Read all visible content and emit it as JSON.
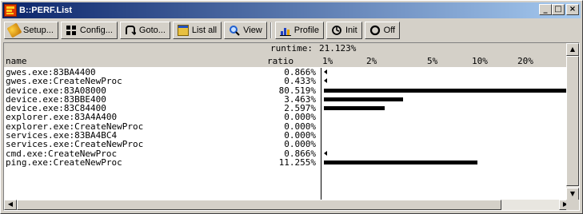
{
  "window": {
    "title": "B::PERF.List"
  },
  "toolbar": {
    "setup": "Setup...",
    "config": "Config...",
    "goto": "Goto...",
    "list_all": "List all",
    "view": "View",
    "profile": "Profile",
    "init": "Init",
    "off": "Off"
  },
  "header": {
    "runtime_label": "runtime:",
    "runtime_value": "21.123%",
    "name": "name",
    "ratio": "ratio",
    "ticks": [
      "1%",
      "2%",
      "5%",
      "10%",
      "20%"
    ]
  },
  "rows": [
    {
      "name": "gwes.exe:83BA4400",
      "ratio": "0.866%",
      "ratio_value": 0.866,
      "bar": "arrow"
    },
    {
      "name": "gwes.exe:CreateNewProc",
      "ratio": "0.433%",
      "ratio_value": 0.433,
      "bar": "arrow"
    },
    {
      "name": "device.exe:83A08000",
      "ratio": "80.519%",
      "ratio_value": 80.519,
      "bar": "bar"
    },
    {
      "name": "device.exe:83BBE400",
      "ratio": "3.463%",
      "ratio_value": 3.463,
      "bar": "bar"
    },
    {
      "name": "device.exe:83C84400",
      "ratio": "2.597%",
      "ratio_value": 2.597,
      "bar": "bar"
    },
    {
      "name": "explorer.exe:83A4A400",
      "ratio": "0.000%",
      "ratio_value": 0.0,
      "bar": "none"
    },
    {
      "name": "explorer.exe:CreateNewProc",
      "ratio": "0.000%",
      "ratio_value": 0.0,
      "bar": "none"
    },
    {
      "name": "services.exe:83BA4BC4",
      "ratio": "0.000%",
      "ratio_value": 0.0,
      "bar": "none"
    },
    {
      "name": "services.exe:CreateNewProc",
      "ratio": "0.000%",
      "ratio_value": 0.0,
      "bar": "none"
    },
    {
      "name": "cmd.exe:CreateNewProc",
      "ratio": "0.866%",
      "ratio_value": 0.866,
      "bar": "arrow"
    },
    {
      "name": "ping.exe:CreateNewProc",
      "ratio": "11.255%",
      "ratio_value": 11.255,
      "bar": "bar"
    }
  ]
}
